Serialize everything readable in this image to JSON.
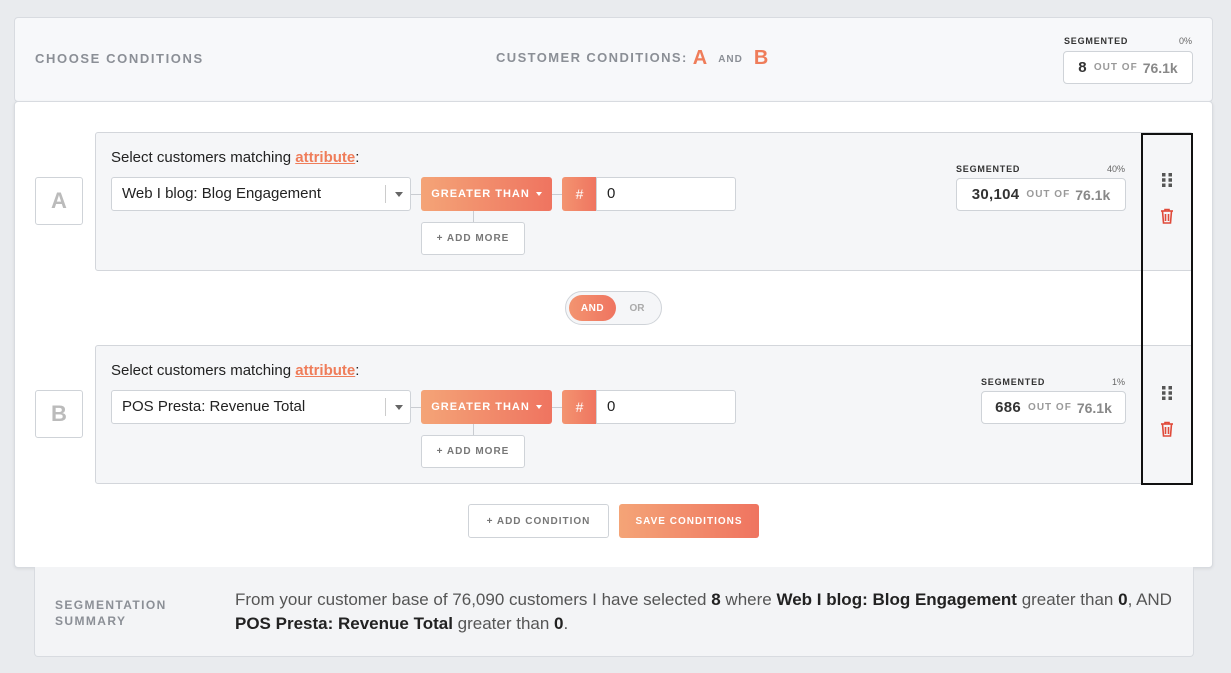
{
  "header": {
    "choose_title": "CHOOSE CONDITIONS",
    "customer_conditions_label": "CUSTOMER CONDITIONS:",
    "cond_a": "A",
    "and_word": "AND",
    "cond_b": "B",
    "segmented": {
      "label": "SEGMENTED",
      "percent": "0%",
      "count": "8",
      "out_of": "OUT OF",
      "total": "76.1k"
    }
  },
  "conditions": [
    {
      "letter": "A",
      "prompt_prefix": "Select customers matching",
      "prompt_link": "attribute",
      "prompt_suffix": ":",
      "attribute": "Web I blog: Blog Engagement",
      "operator": "GREATER THAN",
      "hash": "#",
      "value": "0",
      "add_more": "+ ADD MORE",
      "segmented": {
        "label": "SEGMENTED",
        "percent": "40%",
        "count": "30,104",
        "out_of": "OUT OF",
        "total": "76.1k"
      }
    },
    {
      "letter": "B",
      "prompt_prefix": "Select customers matching",
      "prompt_link": "attribute",
      "prompt_suffix": ":",
      "attribute": "POS Presta: Revenue Total",
      "operator": "GREATER THAN",
      "hash": "#",
      "value": "0",
      "add_more": "+ ADD MORE",
      "segmented": {
        "label": "SEGMENTED",
        "percent": "1%",
        "count": "686",
        "out_of": "OUT OF",
        "total": "76.1k"
      }
    }
  ],
  "logic_toggle": {
    "and": "AND",
    "or": "OR",
    "selected": "AND"
  },
  "actions": {
    "add_condition": "+ ADD CONDITION",
    "save_conditions": "SAVE CONDITIONS"
  },
  "summary": {
    "title": "SEGMENTATION SUMMARY",
    "text_1": "From your customer base of 76,090 customers I have selected ",
    "count": "8",
    "text_2": " where ",
    "attr_a": "Web I blog: Blog Engagement",
    "text_3": " greater than ",
    "value_a": "0",
    "text_4": ", AND ",
    "attr_b": "POS Presta: Revenue Total",
    "text_5": " greater than ",
    "value_b": "0",
    "text_6": "."
  },
  "colors": {
    "accent": "#ef7d5a",
    "muted": "#8b8f96"
  },
  "icons": {
    "handle": "drag-handle-icon",
    "delete": "trash-icon",
    "caret": "chevron-down-icon"
  }
}
